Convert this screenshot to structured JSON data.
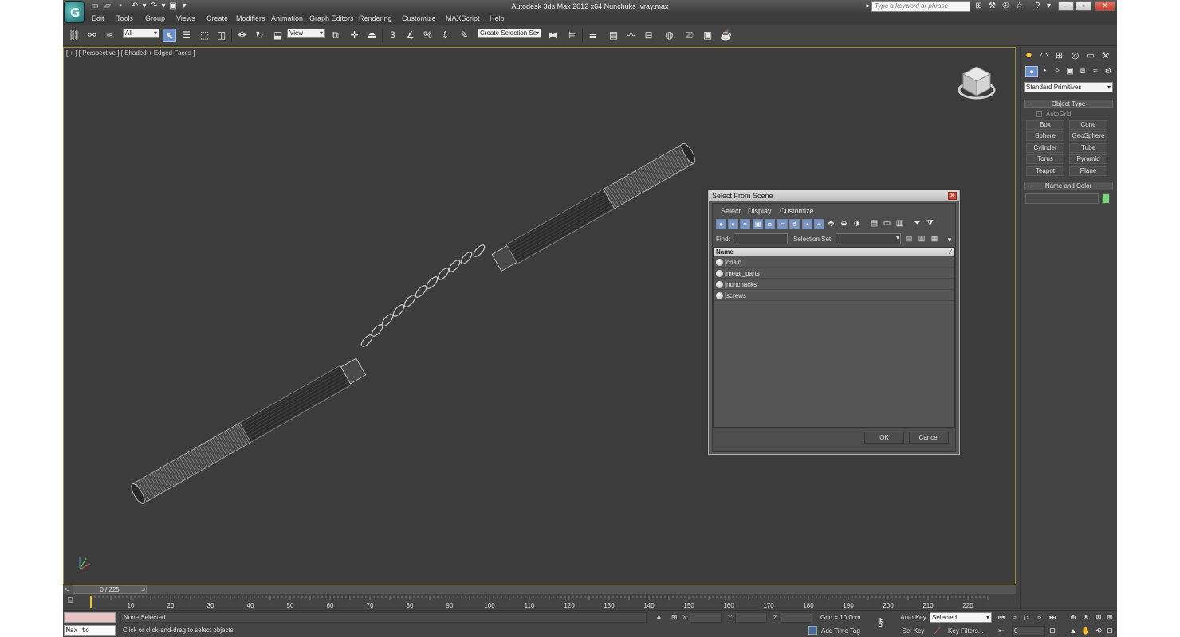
{
  "window": {
    "title": "Autodesk 3ds Max  2012 x64      Nunchuks_vray.max",
    "search_placeholder": "Type a keyword or phrase"
  },
  "menu": [
    "Edit",
    "Tools",
    "Group",
    "Views",
    "Create",
    "Modifiers",
    "Animation",
    "Graph Editors",
    "Rendering",
    "Customize",
    "MAXScript",
    "Help"
  ],
  "toolbar": {
    "selection_filter": "All",
    "reference_coord": "View",
    "named_selection": "Create Selection Se",
    "snaps_label": "3",
    "angle_snap_label": "%"
  },
  "viewport": {
    "label": "[ + ] [ Perspective ] [ Shaded + Edged Faces ]",
    "background": "#3c3c3c",
    "border_color": "#9a8d36"
  },
  "command_panel": {
    "category": "Standard Primitives",
    "object_type_title": "Object Type",
    "autogrid": "AutoGrid",
    "primitives": [
      "Box",
      "Cone",
      "Sphere",
      "GeoSphere",
      "Cylinder",
      "Tube",
      "Torus",
      "Pyramid",
      "Teapot",
      "Plane"
    ],
    "name_color_title": "Name and Color",
    "object_color": "#7cd67c"
  },
  "time_slider": {
    "position": "0 / 225",
    "prev": "<",
    "next": ">",
    "ticks": [
      "10",
      "20",
      "30",
      "40",
      "50",
      "60",
      "70",
      "80",
      "90",
      "100",
      "110",
      "120",
      "130",
      "140",
      "150",
      "160",
      "170",
      "180",
      "190",
      "200",
      "210",
      "220"
    ]
  },
  "status": {
    "maxscript": "Max to Physc:",
    "selection": "None Selected",
    "prompt": "Click or click-and-drag to select objects",
    "x_label": "X:",
    "y_label": "Y:",
    "z_label": "Z:",
    "grid": "Grid = 10,0cm",
    "add_time_tag": "Add Time Tag",
    "auto_key": "Auto Key",
    "set_key": "Set Key",
    "selected": "Selected",
    "key_filters": "Key Filters...",
    "frame": "0"
  },
  "dialog": {
    "title": "Select From Scene",
    "menus": [
      "Select",
      "Display",
      "Customize"
    ],
    "find_label": "Find:",
    "selection_set_label": "Selection Set:",
    "column_name": "Name",
    "items": [
      "chain",
      "metal_parts",
      "nunchacks",
      "screws"
    ],
    "ok": "OK",
    "cancel": "Cancel"
  }
}
